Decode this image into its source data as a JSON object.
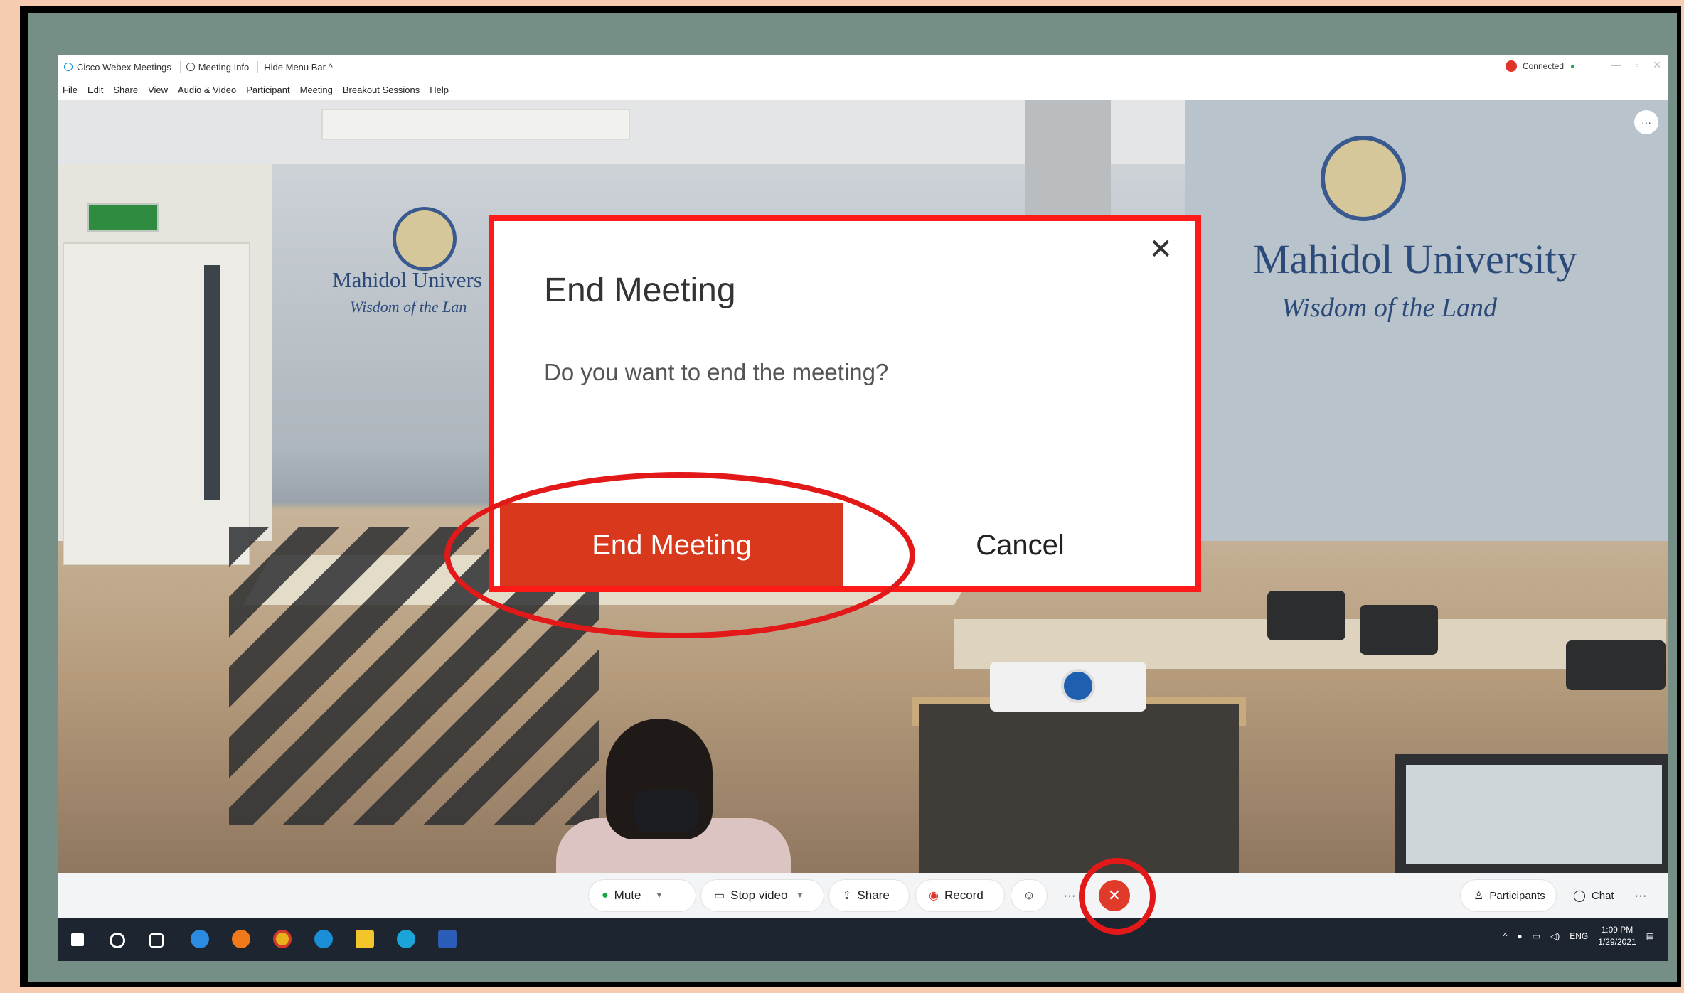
{
  "titlebar": {
    "app_name": "Cisco Webex Meetings",
    "meeting_info": "Meeting Info",
    "hide_menu": "Hide Menu Bar ^",
    "status": "Connected",
    "win_min": "—",
    "win_max": "▫",
    "win_close": "✕"
  },
  "menu": [
    "File",
    "Edit",
    "Share",
    "View",
    "Audio & Video",
    "Participant",
    "Meeting",
    "Breakout Sessions",
    "Help"
  ],
  "video": {
    "logo_text_right": "Mahidol University",
    "logo_sub_right": "Wisdom of the Land",
    "logo_text_left": "Mahidol Univers",
    "logo_sub_left": "Wisdom of the Lan"
  },
  "dialog": {
    "title": "End Meeting",
    "message": "Do you want to end the meeting?",
    "end_label": "End Meeting",
    "cancel_label": "Cancel",
    "close_glyph": "✕"
  },
  "controls": {
    "mute": "Mute",
    "stop_video": "Stop video",
    "share": "Share",
    "record": "Record",
    "more": "···",
    "end_glyph": "✕",
    "participants": "Participants",
    "chat": "Chat"
  },
  "taskbar": {
    "lang": "ENG",
    "time": "1:09 PM",
    "date": "1/29/2021"
  },
  "colors": {
    "end_red": "#d8381c",
    "highlight_red": "#ff1a1a",
    "taskbar": "#1c2530"
  }
}
